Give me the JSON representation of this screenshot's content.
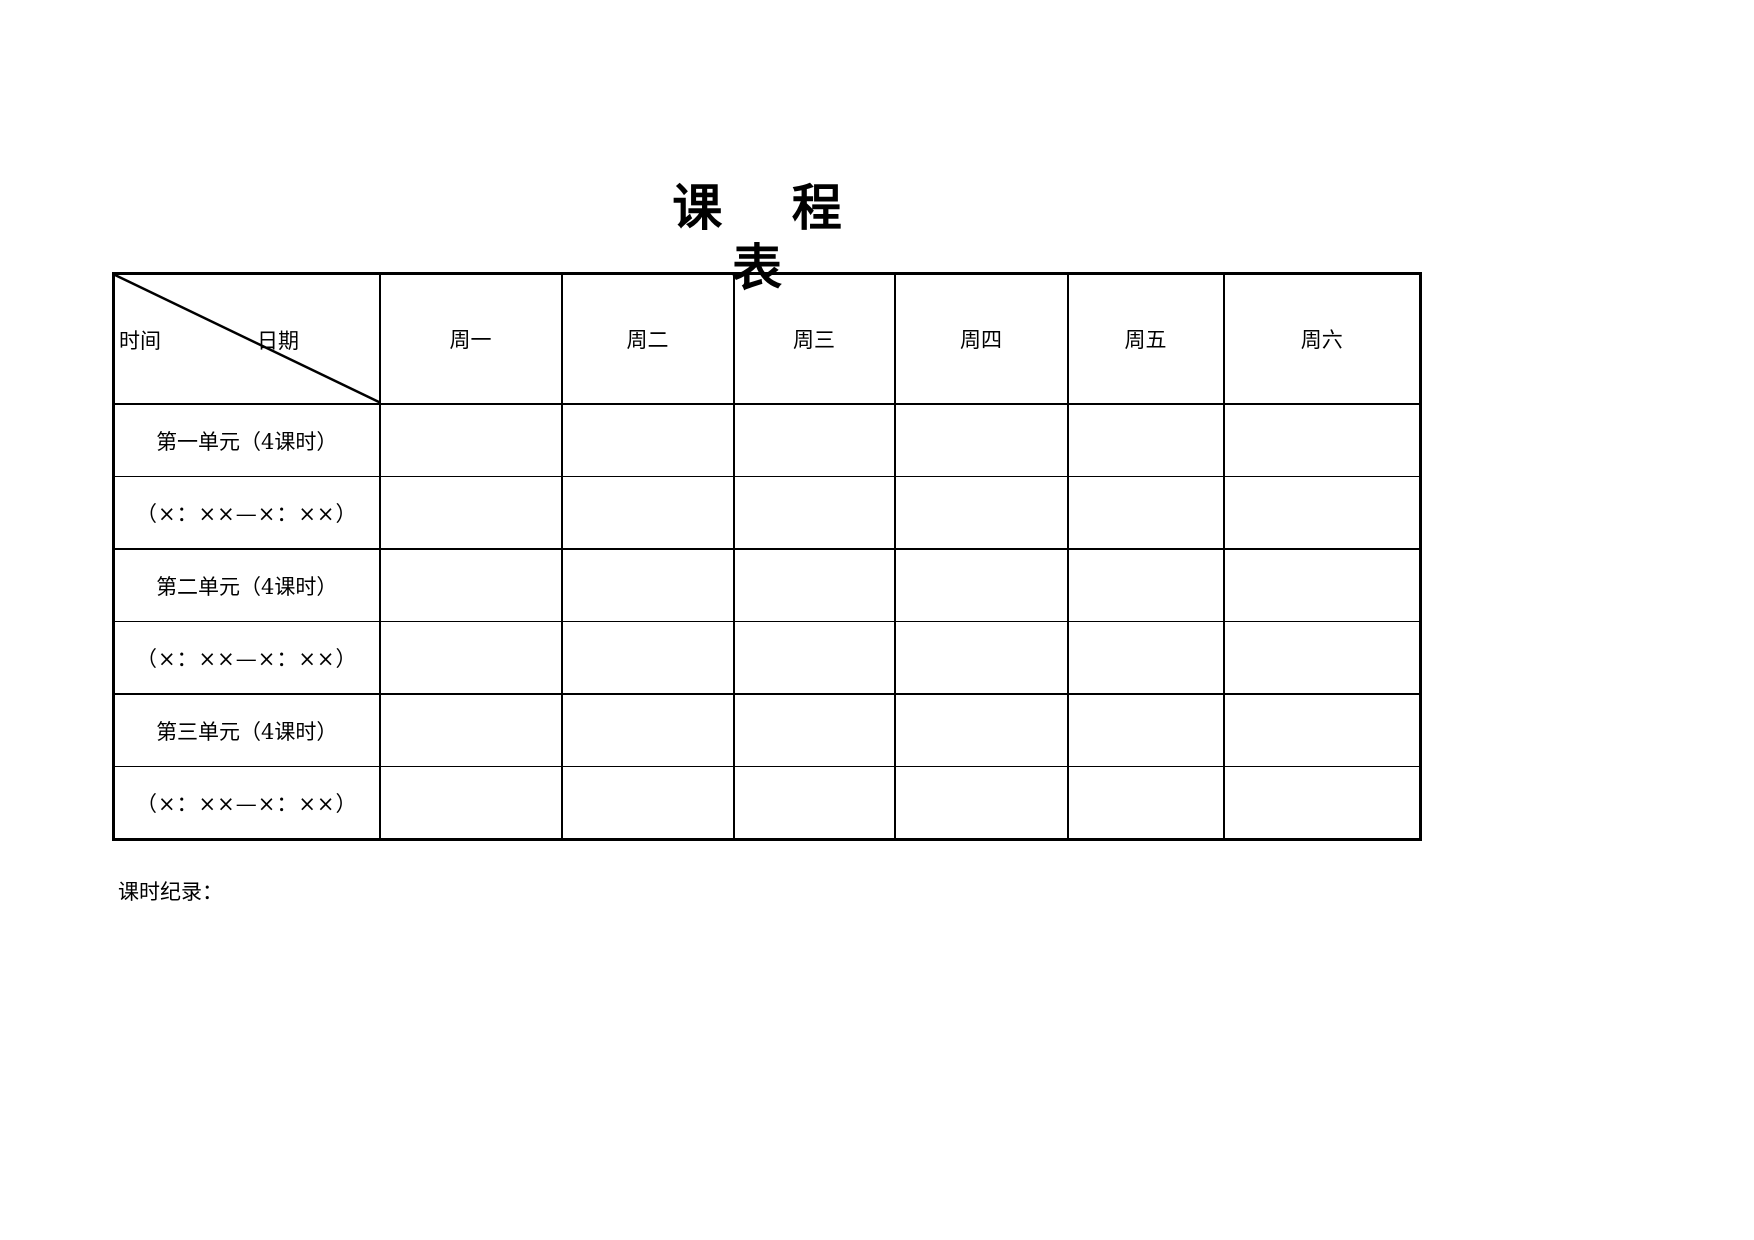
{
  "title": "课 程 表",
  "header": {
    "corner_left": "时间",
    "corner_right": "日期",
    "days": [
      "周一",
      "周二",
      "周三",
      "周四",
      "周五",
      "周六"
    ]
  },
  "rows": [
    {
      "label": "第一单元（4课时）",
      "cells": [
        "",
        "",
        "",
        "",
        "",
        ""
      ]
    },
    {
      "label": "（×：××—×：××）",
      "cells": [
        "",
        "",
        "",
        "",
        "",
        ""
      ]
    },
    {
      "label": "第二单元（4课时）",
      "cells": [
        "",
        "",
        "",
        "",
        "",
        ""
      ]
    },
    {
      "label": "（×：××—×：××）",
      "cells": [
        "",
        "",
        "",
        "",
        "",
        ""
      ]
    },
    {
      "label": "第三单元（4课时）",
      "cells": [
        "",
        "",
        "",
        "",
        "",
        ""
      ]
    },
    {
      "label": "（×：××—×：××）",
      "cells": [
        "",
        "",
        "",
        "",
        "",
        ""
      ]
    }
  ],
  "footer": {
    "label": "课时纪录："
  }
}
